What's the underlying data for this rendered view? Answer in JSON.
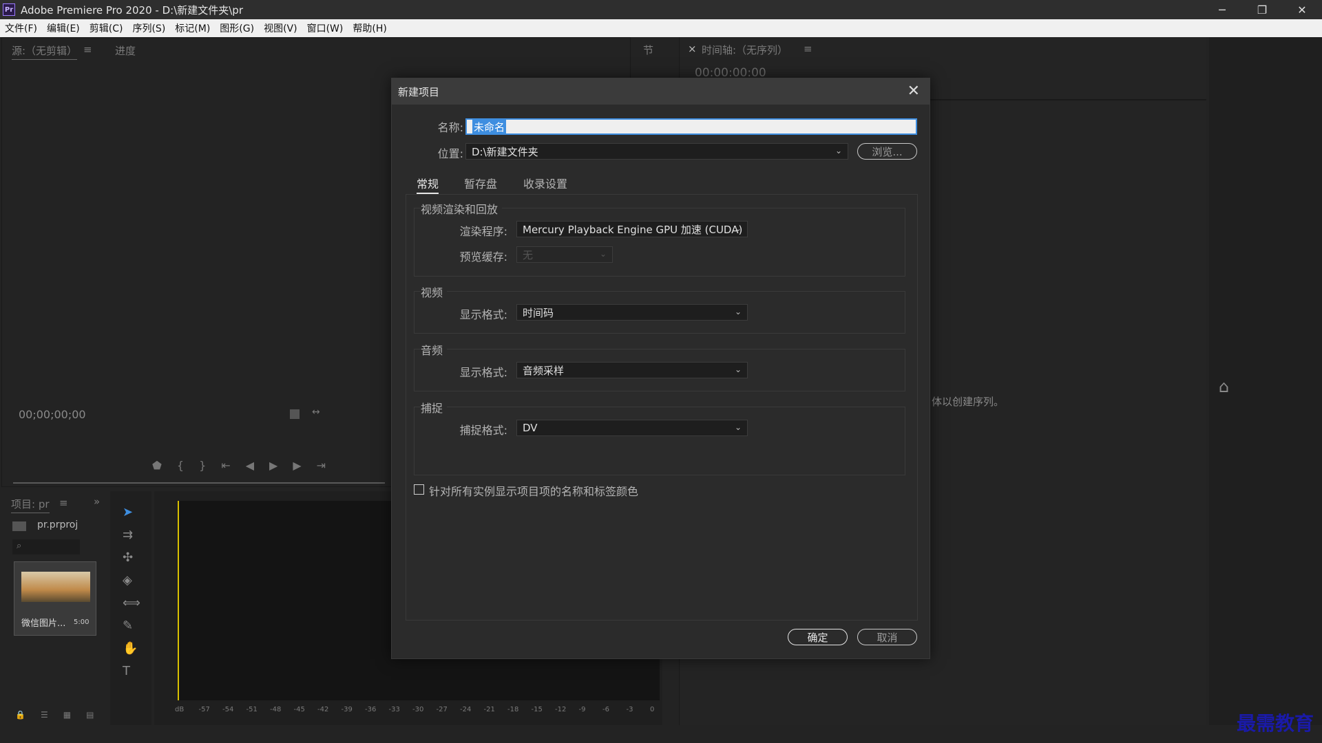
{
  "window": {
    "title": "Adobe Premiere Pro 2020 - D:\\新建文件夹\\pr",
    "minimize": "─",
    "restore": "❐",
    "close": "✕"
  },
  "menu": [
    "文件(F)",
    "编辑(E)",
    "剪辑(C)",
    "序列(S)",
    "标记(M)",
    "图形(G)",
    "视图(V)",
    "窗口(W)",
    "帮助(H)"
  ],
  "source_panel": {
    "tab_source": "源:（无剪辑）",
    "tab_progress": "进度",
    "timecode": "00;00;00;00"
  },
  "timeline_panel": {
    "tab_close": "×",
    "tab_title": "时间轴:（无序列）",
    "timecode": "00:00:00:00",
    "hint": "体以创建序列。",
    "section_tab": "节"
  },
  "project_panel": {
    "tab": "项目: pr",
    "file": "pr.prproj",
    "thumb_label": "微信图片...",
    "thumb_duration": "5:00"
  },
  "meter_labels": [
    "dB",
    "-57",
    "-54",
    "-51",
    "-48",
    "-45",
    "-42",
    "-39",
    "-36",
    "-33",
    "-30",
    "-27",
    "-24",
    "-21",
    "-18",
    "-15",
    "-12",
    "-9",
    "-6",
    "-3",
    "0"
  ],
  "dialog": {
    "title": "新建项目",
    "name_label": "名称:",
    "name_value": "未命名",
    "location_label": "位置:",
    "location_value": "D:\\新建文件夹",
    "browse_button": "浏览...",
    "tabs": [
      "常规",
      "暂存盘",
      "收录设置"
    ],
    "groups": {
      "video_render": {
        "title": "视频渲染和回放",
        "renderer_label": "渲染程序:",
        "renderer_value": "Mercury Playback Engine GPU 加速 (CUDA)",
        "preview_cache_label": "预览缓存:",
        "preview_cache_value": "无"
      },
      "video": {
        "title": "视频",
        "display_format_label": "显示格式:",
        "display_format_value": "时间码"
      },
      "audio": {
        "title": "音频",
        "display_format_label": "显示格式:",
        "display_format_value": "音频采样"
      },
      "capture": {
        "title": "捕捉",
        "capture_format_label": "捕捉格式:",
        "capture_format_value": "DV"
      }
    },
    "checkbox_label": "针对所有实例显示项目项的名称和标签颜色",
    "ok_button": "确定",
    "cancel_button": "取消"
  },
  "watermark": "最需教育"
}
